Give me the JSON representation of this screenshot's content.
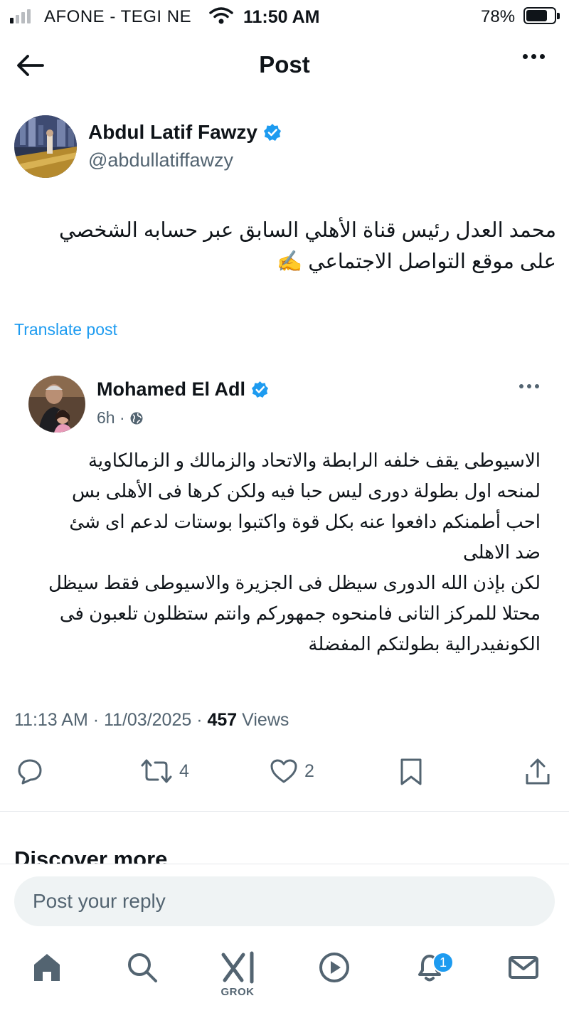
{
  "status_bar": {
    "carrier": "AFONE - TEGI NE",
    "time": "11:50 AM",
    "battery_percent": "78%",
    "battery_level": 0.78,
    "signal_bars_filled": 1,
    "signal_bars_total": 4
  },
  "header": {
    "title": "Post",
    "back_icon": "arrow-left-icon",
    "more_icon": "more-horizontal-icon"
  },
  "post": {
    "author_name": "Abdul Latif Fawzy",
    "author_handle": "@abdullatiffawzy",
    "verified": true,
    "text_lines": [
      "محمد العدل رئيس قناة الأهلي السابق عبر حسابه الشخصي",
      "على موقع التواصل الاجتماعي ✍️"
    ],
    "translate_label": "Translate post",
    "timestamp": "11:13 AM · 11/03/2025 · ",
    "views_count": "457",
    "views_label": " Views"
  },
  "quoted_post": {
    "author_name": "Mohamed El Adl",
    "verified": true,
    "time_ago": "6h ·",
    "text_lines": [
      "الاسيوطى يقف خلفه الرابطة والاتحاد والزمالك و الزمالكاوية",
      "لمنحه اول بطولة دورى ليس حبا فيه ولكن كرها فى الأهلى بس",
      "احب أطمنكم دافعوا عنه بكل قوة واكتبوا بوستات لدعم اى شئ",
      "ضد الاهلى",
      "لكن بإذن الله الدورى سيظل فى الجزيرة والاسيوطى فقط سيظل",
      "محتلا للمركز التانى فامنحوه جمهوركم وانتم ستظلون تلعبون فى",
      "الكونفيدرالية بطولتكم المفضلة"
    ]
  },
  "actions": {
    "reply_count": "",
    "repost_count": "4",
    "like_count": "2"
  },
  "discover_label": "Discover more",
  "reply_placeholder": "Post your reply",
  "bottom_nav": {
    "grok_label": "GROK",
    "notification_count": "1"
  },
  "colors": {
    "accent": "#1d9bf0",
    "text_primary": "#0f1419",
    "text_secondary": "#536471"
  }
}
